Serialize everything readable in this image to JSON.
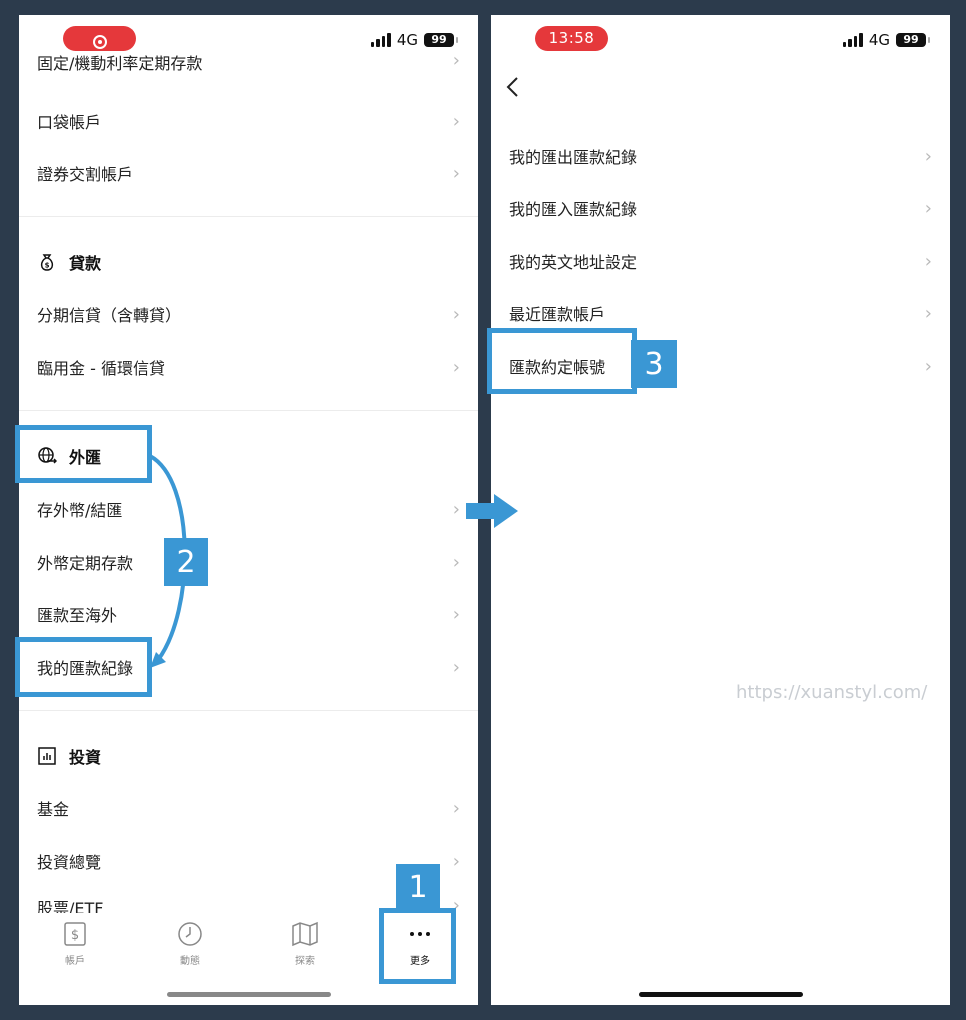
{
  "left_screen": {
    "rows_top": [
      {
        "label": "固定/機動利率定期存款"
      },
      {
        "label": "口袋帳戶"
      },
      {
        "label": "證券交割帳戶"
      }
    ],
    "loans": {
      "title": "貸款",
      "icon": "money-bag-icon",
      "rows": [
        {
          "label": "分期信貸（含轉貸）"
        },
        {
          "label": "臨用金 - 循環信貸"
        }
      ]
    },
    "fx": {
      "title": "外匯",
      "icon": "globe-exchange-icon",
      "rows": [
        {
          "label": "存外幣/結匯"
        },
        {
          "label": "外幣定期存款"
        },
        {
          "label": "匯款至海外"
        },
        {
          "label": "我的匯款紀錄"
        }
      ]
    },
    "invest": {
      "title": "投資",
      "icon": "bar-chart-icon",
      "rows": [
        {
          "label": "基金"
        },
        {
          "label": "投資總覽"
        },
        {
          "label": "股票/ETF"
        }
      ]
    },
    "tabs": [
      {
        "label": "帳戶",
        "icon": "dollar-card-icon"
      },
      {
        "label": "動態",
        "icon": "clock-icon"
      },
      {
        "label": "探索",
        "icon": "map-icon"
      },
      {
        "label": "更多",
        "icon": "more-dots-icon"
      }
    ]
  },
  "right_screen": {
    "status_time": "13:58",
    "rows": [
      {
        "label": "我的匯出匯款紀錄"
      },
      {
        "label": "我的匯入匯款紀錄"
      },
      {
        "label": "我的英文地址設定"
      },
      {
        "label": "最近匯款帳戶"
      },
      {
        "label": "匯款約定帳號"
      }
    ]
  },
  "status": {
    "network": "4G",
    "battery": "99"
  },
  "annotations": {
    "step1": "1",
    "step2": "2",
    "step3": "3"
  },
  "watermark": "https://xuanstyl.com/",
  "colors": {
    "highlight": "#3a97d4",
    "record_pill": "#e5383b",
    "background": "#2c3b4c"
  }
}
